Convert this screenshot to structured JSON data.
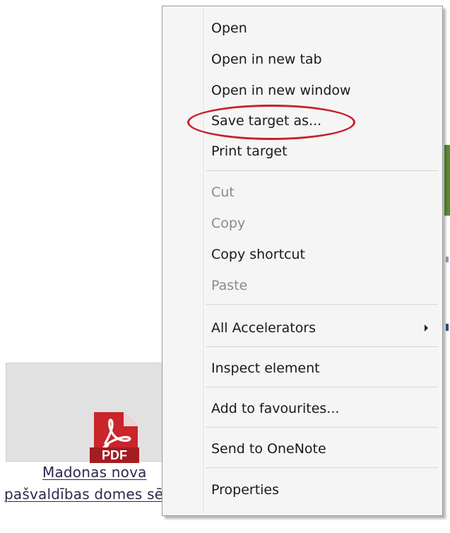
{
  "context_menu": {
    "items": [
      {
        "label": "Open",
        "enabled": true
      },
      {
        "label": "Open in new tab",
        "enabled": true
      },
      {
        "label": "Open in new window",
        "enabled": true
      },
      {
        "label": "Save target as...",
        "enabled": true,
        "highlighted": true
      },
      {
        "label": "Print target",
        "enabled": true
      },
      {
        "label": "Cut",
        "enabled": false
      },
      {
        "label": "Copy",
        "enabled": false
      },
      {
        "label": "Copy shortcut",
        "enabled": true
      },
      {
        "label": "Paste",
        "enabled": false
      },
      {
        "label": "All Accelerators",
        "enabled": true,
        "has_submenu": true
      },
      {
        "label": "Inspect element",
        "enabled": true
      },
      {
        "label": "Add to favourites...",
        "enabled": true
      },
      {
        "label": "Send to OneNote",
        "enabled": true
      },
      {
        "label": "Properties",
        "enabled": true
      }
    ]
  },
  "document_tile": {
    "icon": "pdf-file-icon",
    "icon_text": "PDF",
    "link_line1": "Madonas nova",
    "link_line2": "pašvaldības domes sēde"
  },
  "colors": {
    "highlight_ring": "#c8202a",
    "pdf_red": "#c9252b",
    "link_text": "#2a2a50",
    "menu_background": "#f5f5f5"
  }
}
